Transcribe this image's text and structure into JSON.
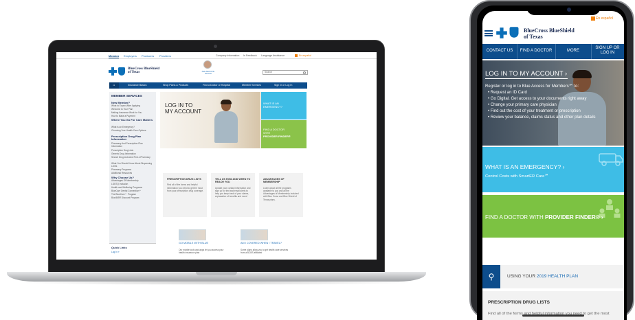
{
  "colors": {
    "brand_blue": "#0d4d8c",
    "link_blue": "#1b6cb5",
    "emergency_cyan": "#3ebde6",
    "provider_green": "#8bc34a",
    "accent_orange": "#f07f09"
  },
  "desktop": {
    "audience_tabs": [
      "Member",
      "Employers",
      "Producers",
      "Providers"
    ],
    "utility_links": [
      "Company Information",
      "In Feedback",
      "Language Assistance",
      "En español"
    ],
    "brand_line1": "BlueCross BlueShield",
    "brand_line2": "of Texas",
    "chat_text": "Ask ARA ONL Service",
    "search_placeholder": "Search",
    "nav": [
      "Insurance Basics",
      "Shop Plans & Products",
      "Find a Doctor or Hospital",
      "Member Services",
      "Sign In or Log In"
    ],
    "sidebar": {
      "heading": "MEMBER SERVICES",
      "groups": [
        {
          "title": "New Member?",
          "links": [
            "What to Expect After Applying",
            "Welcome to Your Plan",
            "Making Insurance Work for You",
            "How to Make a Payment"
          ]
        },
        {
          "title": "Where You Go For Care Matters",
          "links": [
            "What is an Emergency?",
            "Choosing Your Health Care Options"
          ]
        },
        {
          "title": "Prescription Drug Plan Information",
          "links": [
            "Pharmacy And Prescription Plan Information",
            "Prescription Drug Lists",
            "Generic Drug Information",
            "Search Drug Lists And Find a Pharmacy",
            "What You Should Know About Dispensing Limits",
            "Pharmacy Programs",
            "Additional Resources"
          ]
        },
        {
          "title": "Why Choose Us?",
          "links": [
            "Advantages Of Membership",
            "LGBTQ Inclusion",
            "Health and Wellbeing Programs",
            "BlueCare Dental Connection℠",
            "The BlueCare℠ Program",
            "Blue365® Discount Program"
          ]
        }
      ],
      "quick_links": "Quick Links",
      "quick_login": "Log In »"
    },
    "hero_title_1": "LOG IN TO",
    "hero_title_2": "MY ACCOUNT",
    "emergency_1": "WHAT IS AN",
    "emergency_2": "EMERGENCY?",
    "provider_1": "FIND A DOCTOR",
    "provider_2": "WITH",
    "provider_3": "PROVIDER FINDER®",
    "cards": [
      {
        "title": "PRESCRIPTION DRUG LISTS",
        "body": "Find all of the forms and helpful information you need to get the most from your prescription drug coverage."
      },
      {
        "title": "TELL US HOW AND WHEN TO REACH YOU",
        "body": "Update your contact information and sign up for text and email alerts to help you keep track of your claims, explanation of benefits and more!"
      },
      {
        "title": "ADVANTAGES OF MEMBERSHIP",
        "body": "Learn about all the programs available to you and all the Advantages of Membership included with Blue Cross and Blue Shield of Texas plans."
      }
    ],
    "promo_left_title": "GO MOBILE WITH BLUE",
    "promo_left_body": "Our mobile tools and apps let you access your health insurance plan",
    "promo_right_title": "AM I COVERED WHEN I TRAVEL?",
    "promo_right_body": "Some plans allow you to get health care services from a BCBS affiliated"
  },
  "mobile": {
    "brand_line1": "BlueCross BlueShield",
    "brand_line2": "of Texas",
    "espanol": "En español",
    "nav": [
      "CONTACT US",
      "FIND A DOCTOR",
      "MORE",
      "SIGN UP OR LOG IN"
    ],
    "hero_title": "LOG IN TO MY ACCOUNT ›",
    "hero_intro": "Register or log in to Blue Access for Members℠ to:",
    "hero_list": [
      "Request an ID Card",
      "Go Digital. Get access to your documents right away",
      "Change your primary care physician",
      "Find out the cost of your treatment or prescription",
      "Review your balance, claims status and other plan details"
    ],
    "emergency_title": "WHAT IS AN EMERGENCY? ›",
    "emergency_sub": "Control Costs with SmartER Care℠",
    "doctor_title_a": "FIND A DOCTOR WITH ",
    "doctor_title_b": "PROVIDER FINDER® ›",
    "using_a": "USING YOUR ",
    "using_b": "2019 HEALTH PLAN",
    "rx_title": "PRESCRIPTION DRUG LISTS",
    "rx_body": "Find all of the forms and helpful information you need to get the most"
  }
}
